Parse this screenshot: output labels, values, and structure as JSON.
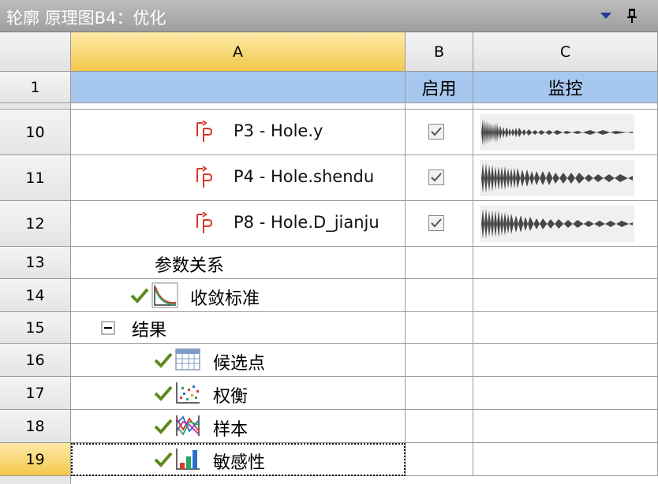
{
  "window": {
    "title": "轮廓 原理图B4：优化",
    "dropdown_icon": "triangle-down-icon",
    "pin_icon": "pin-icon"
  },
  "columns": {
    "a": "A",
    "b": "B",
    "c": "C"
  },
  "header_row": {
    "num": "1",
    "enable": "启用",
    "monitor": "监控"
  },
  "rows": {
    "r10": {
      "num": "10",
      "label": "P3 - Hole.y",
      "enabled": true
    },
    "r11": {
      "num": "11",
      "label": "P4 - Hole.shendu",
      "enabled": true
    },
    "r12": {
      "num": "12",
      "label": "P8 - Hole.D_jianju",
      "enabled": true
    },
    "r13": {
      "num": "13",
      "label": "参数关系"
    },
    "r14": {
      "num": "14",
      "label": "收敛标准"
    },
    "r15": {
      "num": "15",
      "label": "结果"
    },
    "r16": {
      "num": "16",
      "label": "候选点"
    },
    "r17": {
      "num": "17",
      "label": "权衡"
    },
    "r18": {
      "num": "18",
      "label": "样本"
    },
    "r19": {
      "num": "19",
      "label": "敏感性"
    }
  },
  "colors": {
    "title_bar": "#a8a8a8",
    "column_a_header": "#f3c94b",
    "row1_fill": "#a7c8ee",
    "check_green": "#5c8a1e",
    "param_icon_red": "#d9382b"
  }
}
